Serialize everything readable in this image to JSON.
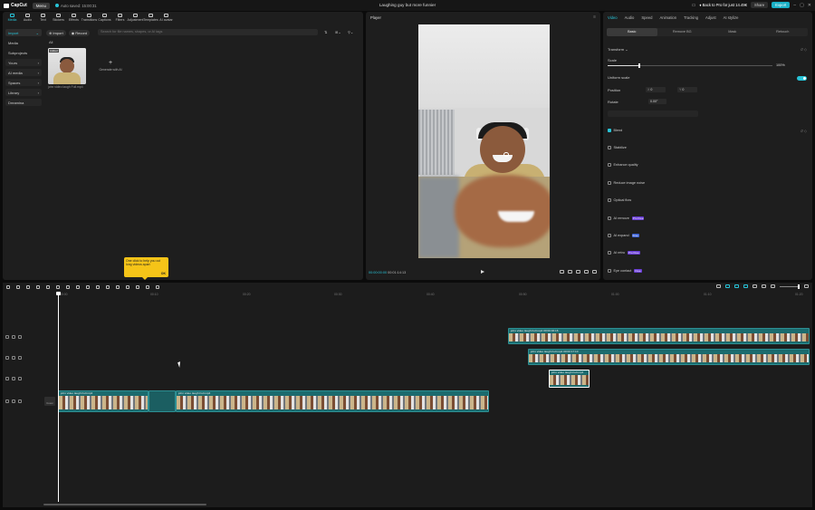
{
  "app": {
    "name": "CapCut",
    "menu": "Menu",
    "autosave": "Auto saved: 15:00:31",
    "project_title": "Laughing guy but more funnier"
  },
  "topbar": {
    "pro_offer": "Back to Pro for just 14.49€",
    "share": "Share",
    "export": "Export"
  },
  "toolbar": {
    "tabs": [
      "Media",
      "Audio",
      "Text",
      "Stickers",
      "Effects",
      "Transitions",
      "Captions",
      "Filters",
      "Adjustment",
      "Templates",
      "AI avatar"
    ],
    "active": "Media"
  },
  "media": {
    "sidebar": [
      {
        "label": "Import",
        "selected": true
      },
      {
        "label": "Media"
      },
      {
        "label": "Subprojects"
      },
      {
        "label": "Yours"
      },
      {
        "label": "AI media"
      },
      {
        "label": "Spaces"
      },
      {
        "label": "Library"
      },
      {
        "label": "Dreamina"
      }
    ],
    "import_label": "Import",
    "record_label": "Record",
    "search_placeholder": "Search for file names, shapes, or AI tags",
    "filter_all": "All",
    "clip_tag": "Added",
    "clip_name": "john video laugh Full.mp4",
    "generate_label": "Generate with AI"
  },
  "tooltip": {
    "text": "One click to help you cut long videos apart",
    "ok": "OK"
  },
  "player": {
    "title": "Player",
    "current_time": "00:00:00:00",
    "total_time": "00:01:14:13"
  },
  "properties": {
    "tabs": [
      "Video",
      "Audio",
      "Speed",
      "Animation",
      "Tracking",
      "Adjust",
      "AI stylize"
    ],
    "active_tab": "Video",
    "subtabs": [
      "Basic",
      "Remove BG",
      "Mask",
      "Retouch"
    ],
    "active_subtab": "Basic",
    "transform": "Transform",
    "scale": "Scale",
    "scale_value": "100%",
    "scale_fraction": 0.19,
    "uniform_scale": "Uniform scale",
    "position": "Position",
    "pos_x_label": "X",
    "pos_x": "0",
    "pos_y_label": "Y",
    "pos_y": "0",
    "rotate": "Rotate",
    "rotate_value": "0.00°",
    "blend": "Blend",
    "features": [
      {
        "label": "Stabilize",
        "badge": ""
      },
      {
        "label": "Enhance quality",
        "badge": ""
      },
      {
        "label": "Reduce image noise",
        "badge": ""
      },
      {
        "label": "Optical flow",
        "badge": ""
      },
      {
        "label": "AI remove",
        "badge": "Pro Free"
      },
      {
        "label": "AI expand",
        "badge": "Free"
      },
      {
        "label": "AI retro",
        "badge": "Pro Free"
      },
      {
        "label": "Eye contact",
        "badge": "Free"
      }
    ]
  },
  "timeline": {
    "ruler": [
      "00:00",
      "00:10",
      "00:20",
      "00:30",
      "00:40",
      "00:50",
      "01:00",
      "01:10",
      "01:20"
    ],
    "clips": [
      {
        "label": "john video laugh Full.mp4  00:00:46:16"
      },
      {
        "label": "john video laugh Full.mp4  00:00:17:10"
      },
      {
        "label": "john video laugh Full.mp4"
      },
      {
        "label": "john video laugh Full.mp4"
      }
    ],
    "cover_label": "Cover"
  },
  "colors": {
    "accent": "#28c4d8",
    "clip": "#1b6b6e",
    "tooltip": "#f5c418"
  }
}
